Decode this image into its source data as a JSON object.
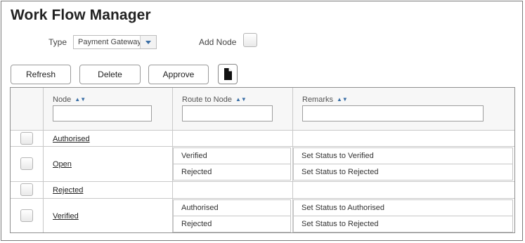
{
  "title": "Work Flow Manager",
  "type_label": "Type",
  "type_value": "Payment Gateway",
  "add_node_label": "Add Node",
  "buttons": {
    "refresh": "Refresh",
    "delete": "Delete",
    "approve": "Approve"
  },
  "columns": {
    "node": "Node",
    "route": "Route to Node",
    "remarks": "Remarks"
  },
  "rows": [
    {
      "node": "Authorised",
      "routes": []
    },
    {
      "node": "Open",
      "routes": [
        {
          "route": "Verified",
          "remark": "Set Status to Verified"
        },
        {
          "route": "Rejected",
          "remark": "Set Status to Rejected"
        }
      ]
    },
    {
      "node": "Rejected",
      "routes": []
    },
    {
      "node": "Verified",
      "routes": [
        {
          "route": "Authorised",
          "remark": "Set Status to Authorised"
        },
        {
          "route": "Rejected",
          "remark": "Set Status to Rejected"
        }
      ]
    }
  ],
  "icons": {
    "sort": "sort-icon",
    "new_document": "document-icon",
    "dropdown": "chevron-down-icon"
  }
}
